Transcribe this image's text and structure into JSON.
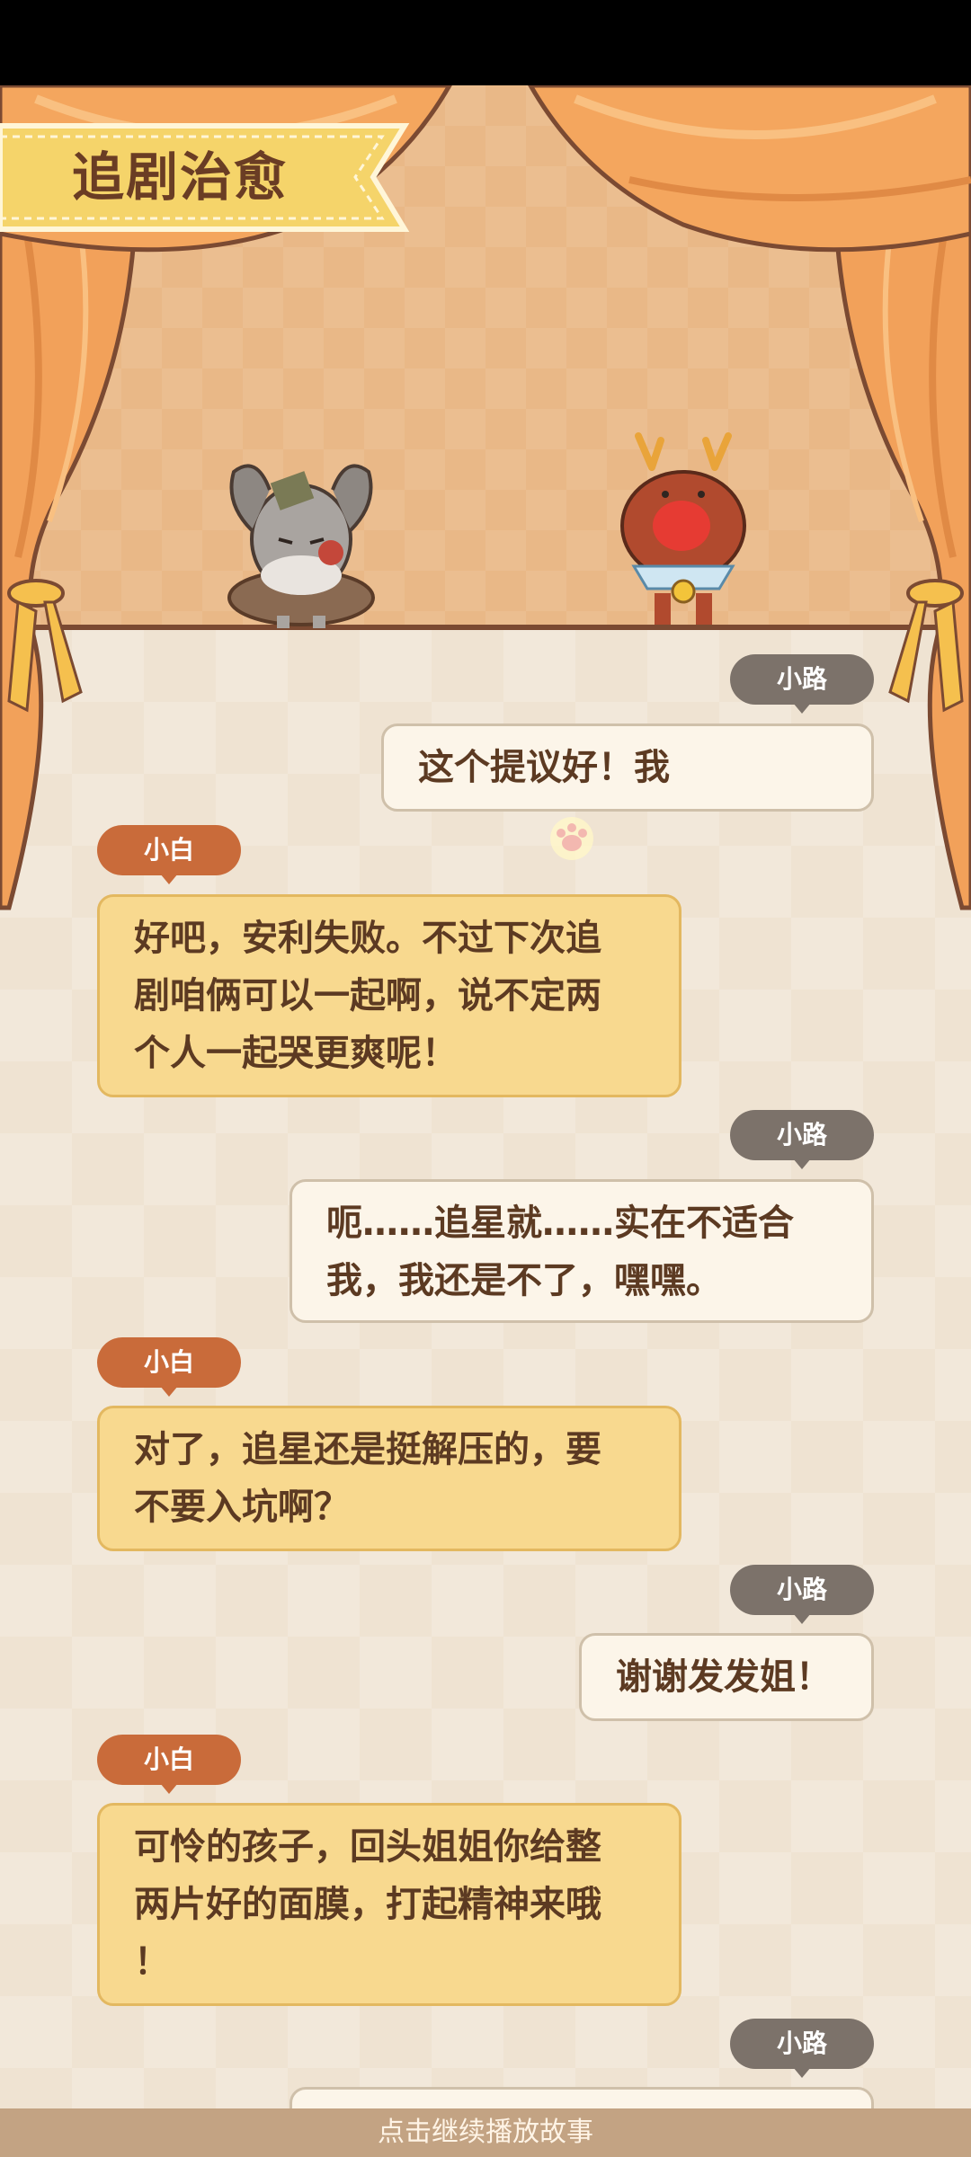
{
  "title": "追剧治愈",
  "messages": [
    {
      "speaker": "小路",
      "side": "right",
      "text": "这个提议好！我"
    },
    {
      "speaker": "小白",
      "side": "left",
      "lines": [
        "好吧，安利失败。不过下次追",
        "剧咱俩可以一起啊，说不定两",
        "个人一起哭更爽呢！"
      ]
    },
    {
      "speaker": "小路",
      "side": "right",
      "lines": [
        "呃……追星就……实在不适合",
        "我，我还是不了，嘿嘿。"
      ]
    },
    {
      "speaker": "小白",
      "side": "left",
      "lines": [
        "对了，追星还是挺解压的，要",
        "不要入坑啊？"
      ]
    },
    {
      "speaker": "小路",
      "side": "right",
      "text": "谢谢发发姐！"
    },
    {
      "speaker": "小白",
      "side": "left",
      "lines": [
        "可怜的孩子，回头姐姐你给整",
        "两片好的面膜，打起精神来哦",
        "！"
      ]
    },
    {
      "speaker": "小路",
      "side": "right",
      "text": ""
    }
  ],
  "continue_hint": "点击继续播放故事",
  "colors": {
    "stage": "#e9b887",
    "curtain": "#f2a15a",
    "right_bubble": "#fcf5e9",
    "left_bubble": "#f8d98f",
    "right_tag": "#7c726a",
    "left_tag": "#c96b3a"
  }
}
